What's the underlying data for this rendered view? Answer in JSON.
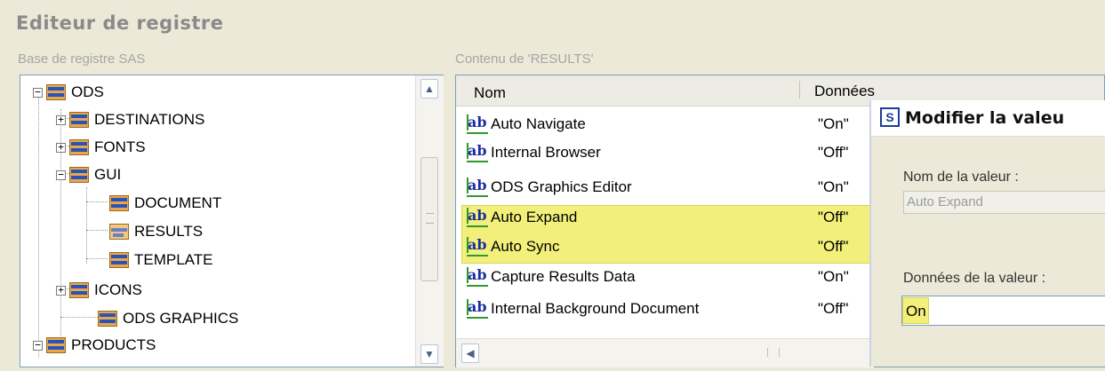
{
  "window": {
    "title": "Editeur de registre"
  },
  "left_panel": {
    "label": "Base de registre SAS",
    "tree": [
      {
        "label": "ODS",
        "expander": "⊟"
      },
      {
        "label": "DESTINATIONS",
        "expander": "⊞"
      },
      {
        "label": "FONTS",
        "expander": "⊞"
      },
      {
        "label": "GUI",
        "expander": "⊟"
      },
      {
        "label": "DOCUMENT",
        "expander": ""
      },
      {
        "label": "RESULTS",
        "expander": ""
      },
      {
        "label": "TEMPLATE",
        "expander": ""
      },
      {
        "label": "ICONS",
        "expander": "⊞"
      },
      {
        "label": "ODS GRAPHICS",
        "expander": ""
      },
      {
        "label": "PRODUCTS",
        "expander": "⊟"
      }
    ],
    "selected": "RESULTS"
  },
  "right_panel": {
    "label": "Contenu de 'RESULTS'",
    "columns": [
      "Nom",
      "Données"
    ],
    "rows": [
      {
        "name": "Auto Navigate",
        "value": "\"On\"",
        "icon": "string-value-icon"
      },
      {
        "name": "Internal Browser",
        "value": "\"Off\"",
        "icon": "string-value-icon"
      },
      {
        "name": "ODS Graphics Editor",
        "value": "\"On\"",
        "icon": "string-value-icon"
      },
      {
        "name": "Auto Expand",
        "value": "\"Off\"",
        "icon": "string-value-icon",
        "highlighted": true
      },
      {
        "name": "Auto Sync",
        "value": "\"Off\"",
        "icon": "string-value-icon",
        "highlighted": true
      },
      {
        "name": "Capture Results Data",
        "value": "\"On\"",
        "icon": "string-value-icon"
      },
      {
        "name": "Internal Background Document",
        "value": "\"Off\"",
        "icon": "string-value-icon"
      }
    ],
    "highlight_color": "#F2F07A"
  },
  "dialog": {
    "title": "Modifier la valeu",
    "value_name_label": "Nom de la valeur :",
    "value_name": "Auto Expand",
    "value_data_label": "Données de la valeur :",
    "value_data": "On"
  }
}
